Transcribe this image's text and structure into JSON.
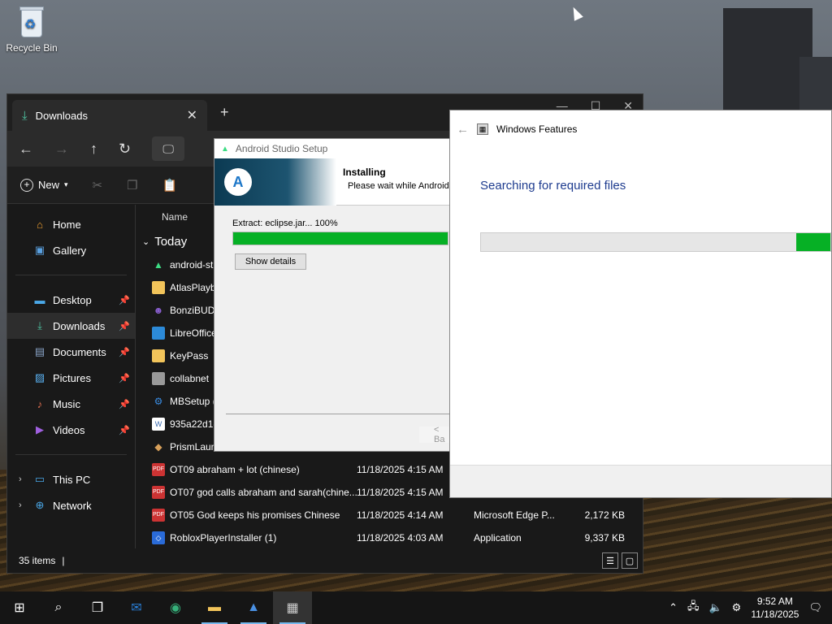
{
  "desktop": {
    "recycle_bin_label": "Recycle Bin"
  },
  "explorer": {
    "tab_title": "Downloads",
    "new_label": "New",
    "column_name": "Name",
    "group_label": "Today",
    "sidebar": [
      {
        "label": "Home",
        "icon": "home-icon"
      },
      {
        "label": "Gallery",
        "icon": "gallery-icon"
      },
      {
        "label": "Desktop",
        "icon": "desktop-icon",
        "pinned": true
      },
      {
        "label": "Downloads",
        "icon": "download-icon",
        "pinned": true
      },
      {
        "label": "Documents",
        "icon": "documents-icon",
        "pinned": true
      },
      {
        "label": "Pictures",
        "icon": "pictures-icon",
        "pinned": true
      },
      {
        "label": "Music",
        "icon": "music-icon",
        "pinned": true
      },
      {
        "label": "Videos",
        "icon": "videos-icon",
        "pinned": true
      },
      {
        "label": "This PC",
        "icon": "pc-icon"
      },
      {
        "label": "Network",
        "icon": "network-icon"
      }
    ],
    "files": [
      {
        "name": "android-st",
        "date": "",
        "type": "",
        "size": ""
      },
      {
        "name": "AtlasPlayb",
        "date": "",
        "type": "",
        "size": ""
      },
      {
        "name": "BonziBUDD",
        "date": "",
        "type": "",
        "size": ""
      },
      {
        "name": "LibreOffice",
        "date": "",
        "type": "",
        "size": ""
      },
      {
        "name": "KeyPass",
        "date": "",
        "type": "",
        "size": ""
      },
      {
        "name": "collabnet",
        "date": "",
        "type": "",
        "size": ""
      },
      {
        "name": "MBSetup (",
        "date": "",
        "type": "",
        "size": ""
      },
      {
        "name": "935a22d1-c",
        "date": "",
        "type": "",
        "size": ""
      },
      {
        "name": "PrismLaun",
        "date": "",
        "type": "",
        "size": ""
      },
      {
        "name": "OT09 abraham + lot (chinese)",
        "date": "11/18/2025 4:15 AM",
        "type": "",
        "size": ""
      },
      {
        "name": "OT07 god calls abraham and sarah(chine...",
        "date": "11/18/2025 4:15 AM",
        "type": "",
        "size": ""
      },
      {
        "name": "OT05 God keeps his promises Chinese",
        "date": "11/18/2025 4:14 AM",
        "type": "Microsoft Edge P...",
        "size": "2,172 KB"
      },
      {
        "name": "RobloxPlayerInstaller (1)",
        "date": "11/18/2025 4:03 AM",
        "type": "Application",
        "size": "9,337 KB"
      }
    ],
    "status_items": "35 items"
  },
  "setup": {
    "title": "Android Studio Setup",
    "header_title": "Installing",
    "header_sub": "Please wait while Android",
    "extract_text": "Extract: eclipse.jar... 100%",
    "progress_percent": 100,
    "details_button": "Show details",
    "back_button": "< Ba"
  },
  "features": {
    "title": "Windows Features",
    "status": "Searching for required files"
  },
  "taskbar": {
    "time": "9:52 AM",
    "date": "11/18/2025"
  },
  "colors": {
    "progress_green": "#06b025",
    "features_status_blue": "#1e3c8f"
  }
}
